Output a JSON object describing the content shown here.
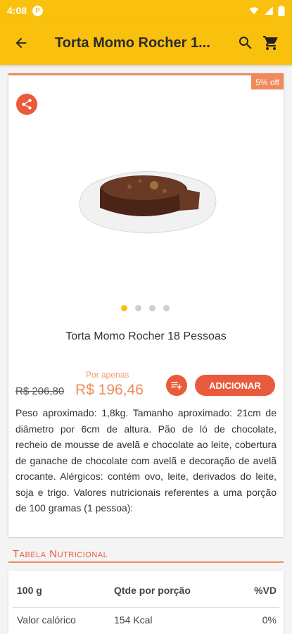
{
  "status_bar": {
    "time": "4:08",
    "badge": "P",
    "icons": [
      "wifi-icon",
      "signal-icon",
      "battery-icon"
    ]
  },
  "app_bar": {
    "title": "Torta Momo Rocher 1...",
    "icons": {
      "back": "arrow-back-icon",
      "search": "search-icon",
      "cart": "cart-icon"
    }
  },
  "product": {
    "discount_badge": "5% off",
    "image_count": 4,
    "active_image_index": 0,
    "name": "Torta Momo Rocher 18 Pessoas",
    "old_price": "R$ 206,80",
    "price_prefix": "Por apenas",
    "price": "R$ 196,46",
    "add_label": "ADICIONAR",
    "description": "Peso aproximado: 1,8kg. Tamanho aproximado: 21cm de diâmetro por 6cm de altura. Pão de ló de chocolate, recheio de mousse de avelã e chocolate ao leite, cobertura de ganache de chocolate com avelã e decoração de avelã crocante. Alérgicos: contém ovo, leite, derivados do leite, soja e trigo. Valores nutricionais referentes a uma porção de 100 gramas (1 pessoa):"
  },
  "nutrition": {
    "title": "Tabela Nutricional",
    "headers": [
      "100 g",
      "Qtde por porção",
      "%VD"
    ],
    "rows": [
      [
        "Valor calórico",
        "154 Kcal",
        "0%"
      ]
    ]
  },
  "colors": {
    "primary": "#f9c10e",
    "accent": "#e95b3c",
    "price": "#f08a5d"
  }
}
